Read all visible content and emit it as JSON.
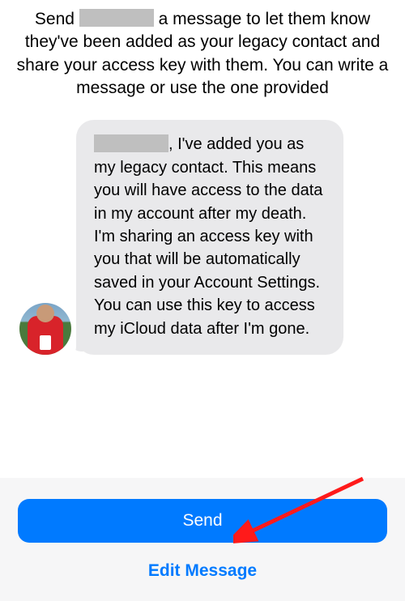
{
  "instructions": {
    "before_name": "Send ",
    "after_name": " a message to let them know they've been added as your legacy contact and share your access key with them. You can write a message or use the one provided"
  },
  "message": {
    "before_name": "",
    "after_name": ", I've added you as my legacy contact. This means you will have access to the data in my account after my death. I'm sharing an access key with you that will be automatically saved in your Account Settings. You can use this key to access my iCloud data after I'm gone."
  },
  "footer": {
    "send_label": "Send",
    "edit_label": "Edit Message"
  },
  "colors": {
    "primary": "#007aff",
    "bubble": "#e9e9eb",
    "redacted": "#bfbfbf"
  },
  "icons": {
    "arrow": "annotation-arrow"
  }
}
